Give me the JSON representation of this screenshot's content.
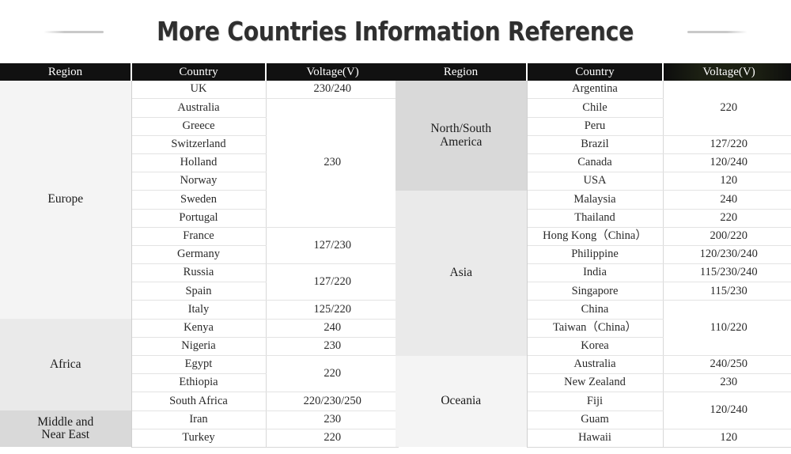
{
  "title": "More Countries Information Reference",
  "columns": {
    "region": "Region",
    "country": "Country",
    "voltage": "Voltage(V)"
  },
  "colors": {
    "header_bg": "#111111",
    "header_tinted_bg": "#1b1f12",
    "header_text": "#ffffff",
    "region_shade_light": "#f4f4f4",
    "region_shade_mid": "#eaeaea",
    "region_shade_dark": "#d9d9d9",
    "body_text": "#2a2a2a",
    "grid_line": "#e3e3e3",
    "title_text": "#2f2f2f",
    "title_rule": "#c9c9c9"
  },
  "left_table": {
    "regions": [
      {
        "name": "Europe",
        "rows": 13,
        "shade": "sh-light"
      },
      {
        "name": "Africa",
        "rows": 5,
        "shade": "sh-mid"
      },
      {
        "name": "Middle and\nNear East",
        "rows": 2,
        "shade": "sh-dark"
      }
    ],
    "rows": [
      {
        "country": "UK",
        "voltage": "230/240",
        "voltage_span": 1
      },
      {
        "country": "Australia",
        "voltage": "230",
        "voltage_span": 7
      },
      {
        "country": "Greece",
        "voltage": null
      },
      {
        "country": "Switzerland",
        "voltage": null
      },
      {
        "country": "Holland",
        "voltage": null
      },
      {
        "country": "Norway",
        "voltage": null
      },
      {
        "country": "Sweden",
        "voltage": null
      },
      {
        "country": "Portugal",
        "voltage": null
      },
      {
        "country": "France",
        "voltage": "127/230",
        "voltage_span": 2
      },
      {
        "country": "Germany",
        "voltage": null
      },
      {
        "country": "Russia",
        "voltage": "127/220",
        "voltage_span": 2
      },
      {
        "country": "Spain",
        "voltage": null
      },
      {
        "country": "Italy",
        "voltage": "125/220",
        "voltage_span": 1
      },
      {
        "country": "Kenya",
        "voltage": "240",
        "voltage_span": 1
      },
      {
        "country": "Nigeria",
        "voltage": "230",
        "voltage_span": 1
      },
      {
        "country": "Egypt",
        "voltage": "220",
        "voltage_span": 2
      },
      {
        "country": "Ethiopia",
        "voltage": null
      },
      {
        "country": "South Africa",
        "voltage": "220/230/250",
        "voltage_span": 1
      },
      {
        "country": "Iran",
        "voltage": "230",
        "voltage_span": 1
      },
      {
        "country": "Turkey",
        "voltage": "220",
        "voltage_span": 1
      }
    ]
  },
  "right_table": {
    "regions": [
      {
        "name": "North/South\nAmerica",
        "rows": 6,
        "shade": "sh-dark"
      },
      {
        "name": "Asia",
        "rows": 9,
        "shade": "sh-mid"
      },
      {
        "name": "Oceania",
        "rows": 5,
        "shade": "sh-light"
      }
    ],
    "rows": [
      {
        "country": "Argentina",
        "voltage": "220",
        "voltage_span": 3
      },
      {
        "country": "Chile",
        "voltage": null
      },
      {
        "country": "Peru",
        "voltage": null
      },
      {
        "country": "Brazil",
        "voltage": "127/220",
        "voltage_span": 1
      },
      {
        "country": "Canada",
        "voltage": "120/240",
        "voltage_span": 1
      },
      {
        "country": "USA",
        "voltage": "120",
        "voltage_span": 1
      },
      {
        "country": "Malaysia",
        "voltage": "240",
        "voltage_span": 1
      },
      {
        "country": "Thailand",
        "voltage": "220",
        "voltage_span": 1
      },
      {
        "country": "Hong Kong（China）",
        "voltage": "200/220",
        "voltage_span": 1
      },
      {
        "country": "Philippine",
        "voltage": "120/230/240",
        "voltage_span": 1
      },
      {
        "country": "India",
        "voltage": "115/230/240",
        "voltage_span": 1
      },
      {
        "country": "Singapore",
        "voltage": "115/230",
        "voltage_span": 1
      },
      {
        "country": "China",
        "voltage": "110/220",
        "voltage_span": 3
      },
      {
        "country": "Taiwan（China）",
        "voltage": null
      },
      {
        "country": "Korea",
        "voltage": null
      },
      {
        "country": "Australia",
        "voltage": "240/250",
        "voltage_span": 1
      },
      {
        "country": "New Zealand",
        "voltage": "230",
        "voltage_span": 1
      },
      {
        "country": "Fiji",
        "voltage": "120/240",
        "voltage_span": 2
      },
      {
        "country": "Guam",
        "voltage": null
      },
      {
        "country": "Hawaii",
        "voltage": "120",
        "voltage_span": 1
      }
    ]
  }
}
